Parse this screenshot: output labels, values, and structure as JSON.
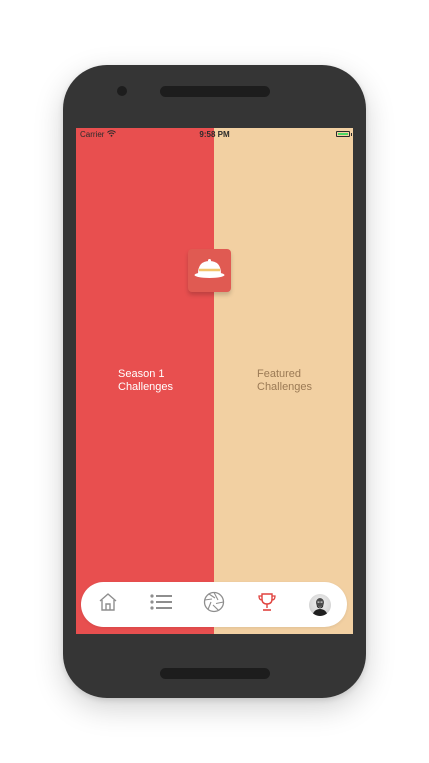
{
  "status_bar": {
    "carrier": "Carrier",
    "time": "9:58 PM",
    "wifi_icon": "wifi-icon",
    "battery_icon": "battery-icon",
    "battery_level": 1.0
  },
  "logo": {
    "icon": "pith-helmet-icon"
  },
  "panels": {
    "left": {
      "line1": "Season 1",
      "line2": "Challenges",
      "color": "#e84f4f"
    },
    "right": {
      "line1": "Featured",
      "line2": "Challenges",
      "color": "#f2d0a2"
    }
  },
  "tab_bar": {
    "items": [
      {
        "icon": "home-icon",
        "active": false
      },
      {
        "icon": "list-icon",
        "active": false
      },
      {
        "icon": "aperture-icon",
        "active": false
      },
      {
        "icon": "trophy-icon",
        "active": true
      },
      {
        "icon": "avatar",
        "active": false
      }
    ],
    "active_color": "#e0423e",
    "inactive_color": "#8e8e8e"
  }
}
